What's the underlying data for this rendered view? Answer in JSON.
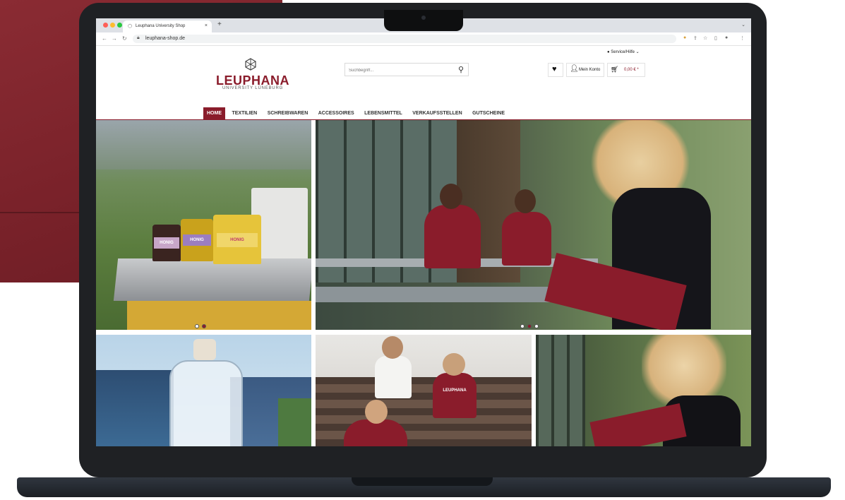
{
  "browser": {
    "tab_title": "Leuphana University Shop",
    "tab_close": "×",
    "new_tab": "+",
    "url": "leuphana-shop.de"
  },
  "header": {
    "service_link": "Service/Hilfe",
    "service_chevron": "⌄",
    "logo_name": "LEUPHANA",
    "logo_subtitle": "UNIVERSITY LÜNEBURG",
    "search_placeholder": "Suchbegriff...",
    "account_label": "Mein Konto",
    "cart_total": "0,00 € *"
  },
  "nav": {
    "items": [
      {
        "label": "HOME",
        "active": true
      },
      {
        "label": "TEXTILIEN",
        "active": false
      },
      {
        "label": "SCHREIBWAREN",
        "active": false
      },
      {
        "label": "ACCESSOIRES",
        "active": false
      },
      {
        "label": "LEBENSMITTEL",
        "active": false
      },
      {
        "label": "VERKAUFSSTELLEN",
        "active": false
      },
      {
        "label": "GUTSCHEINE",
        "active": false
      }
    ]
  },
  "tiles": {
    "honey": {
      "jar_labels": [
        "HONIG",
        "HONIG",
        "HONIG"
      ],
      "carousel_active_index": 1,
      "carousel_count": 2
    },
    "hero": {
      "carousel_active_index": 1,
      "carousel_count": 3
    },
    "hoodie_print": "LEUPHANA"
  },
  "colors": {
    "brand": "#8a1c2b",
    "fabric": "#7a222a",
    "laptop": "#1f2124"
  }
}
